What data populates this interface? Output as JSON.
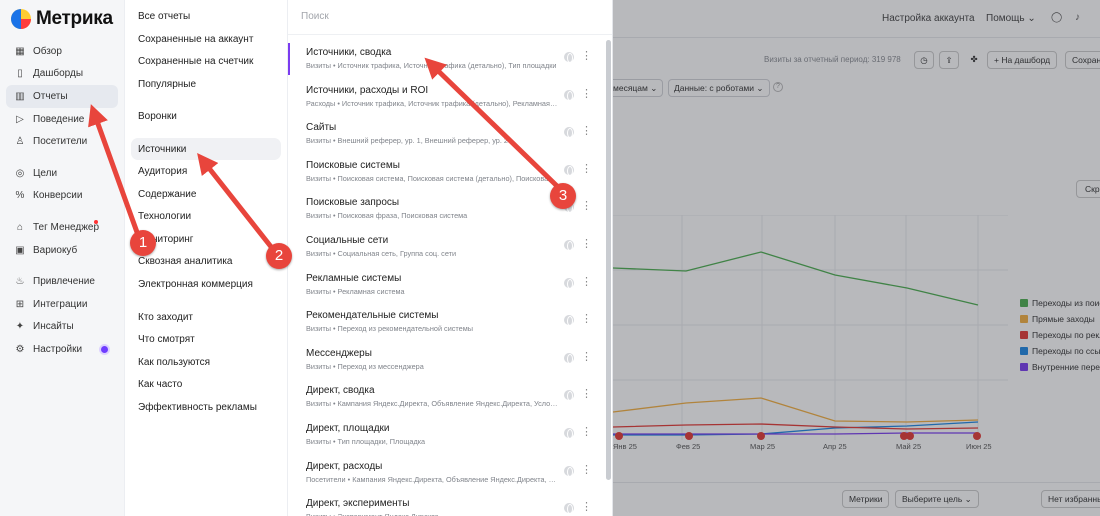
{
  "app": {
    "name": "Метрика"
  },
  "sidebar": {
    "items": [
      {
        "label": "Обзор",
        "icon": "grid-icon"
      },
      {
        "label": "Дашборды",
        "icon": "dashboard-icon"
      },
      {
        "label": "Отчеты",
        "icon": "chart-icon",
        "active": true
      },
      {
        "label": "Поведение",
        "icon": "play-icon"
      },
      {
        "label": "Посетители",
        "icon": "person-icon"
      },
      {
        "label": "Цели",
        "icon": "target-icon"
      },
      {
        "label": "Конверсии",
        "icon": "percent-icon"
      },
      {
        "label": "Тег Менеджер",
        "icon": "tag-icon"
      },
      {
        "label": "Вариокуб",
        "icon": "cube-icon"
      },
      {
        "label": "Привлечение",
        "icon": "fire-icon"
      },
      {
        "label": "Интеграции",
        "icon": "plug-icon"
      },
      {
        "label": "Инсайты",
        "icon": "sparkle-icon"
      },
      {
        "label": "Настройки",
        "icon": "gear-icon"
      }
    ]
  },
  "groups": {
    "items": [
      "Все отчеты",
      "Сохраненные на аккаунт",
      "Сохраненные на счетчик",
      "Популярные",
      "Воронки",
      "Источники",
      "Аудитория",
      "Содержание",
      "Технологии",
      "Мониторинг",
      "Сквозная аналитика",
      "Электронная коммерция",
      "Кто заходит",
      "Что смотрят",
      "Как пользуются",
      "Как часто",
      "Эффективность рекламы"
    ],
    "active": "Источники"
  },
  "reports": {
    "search_placeholder": "Поиск",
    "items": [
      {
        "title": "Источники, сводка",
        "subtitle": "Визиты • Источник трафика, Источник трафика (детально), Тип площадки"
      },
      {
        "title": "Источники, расходы и ROI",
        "subtitle": "Расходы • Источник трафика, Источник трафика (детально), Рекламная система"
      },
      {
        "title": "Сайты",
        "subtitle": "Визиты • Внешний реферер, ур. 1, Внешний реферер, ур. 2"
      },
      {
        "title": "Поисковые системы",
        "subtitle": "Визиты • Поисковая система, Поисковая система (детально), Поисковая фраза"
      },
      {
        "title": "Поисковые запросы",
        "subtitle": "Визиты • Поисковая фраза, Поисковая система"
      },
      {
        "title": "Социальные сети",
        "subtitle": "Визиты • Социальная сеть, Группа соц. сети"
      },
      {
        "title": "Рекламные системы",
        "subtitle": "Визиты • Рекламная система"
      },
      {
        "title": "Рекомендательные системы",
        "subtitle": "Визиты • Переход из рекомендательной системы"
      },
      {
        "title": "Мессенджеры",
        "subtitle": "Визиты • Переход из мессенджера"
      },
      {
        "title": "Директ, сводка",
        "subtitle": "Визиты • Кампания Яндекс.Директа, Объявление Яндекс.Директа, Условие показа"
      },
      {
        "title": "Директ, площадки",
        "subtitle": "Визиты • Тип площадки, Площадка"
      },
      {
        "title": "Директ, расходы",
        "subtitle": "Посетители • Кампания Яндекс.Директа, Объявление Яндекс.Директа, Условие показа"
      },
      {
        "title": "Директ, эксперименты",
        "subtitle": "Визиты • Эксперимент Яндекс.Директа"
      }
    ]
  },
  "background": {
    "account_settings": "Настройка аккаунта",
    "help": "Помощь",
    "visits_period": "Визиты за отчетный период: 319 978",
    "add_to_dashboard": "+ На дашборд",
    "save": "Сохранить",
    "dropdown_period": "месяцам",
    "dropdown_robots": "Данные: с роботами",
    "hide": "Скрыть",
    "metrics": "Метрики",
    "choose_goal": "Выберите цель",
    "no_favorites": "Нет избранных",
    "x_labels": [
      "Янв 25",
      "Фев 25",
      "Мар 25",
      "Апр 25",
      "Май 25",
      "Июн 25"
    ],
    "legend": [
      {
        "label": "Переходы из поисковых систем",
        "color": "#4caf50"
      },
      {
        "label": "Прямые заходы",
        "color": "#f5b041"
      },
      {
        "label": "Переходы по рекламе",
        "color": "#e53935"
      },
      {
        "label": "Переходы по ссылкам на сайтах",
        "color": "#1e88e5"
      },
      {
        "label": "Внутренние переходы",
        "color": "#7b3cf0"
      }
    ]
  },
  "annotations": [
    "1",
    "2",
    "3"
  ],
  "colors": {
    "accent": "#7b3cf0",
    "arrow": "#e8453c"
  }
}
